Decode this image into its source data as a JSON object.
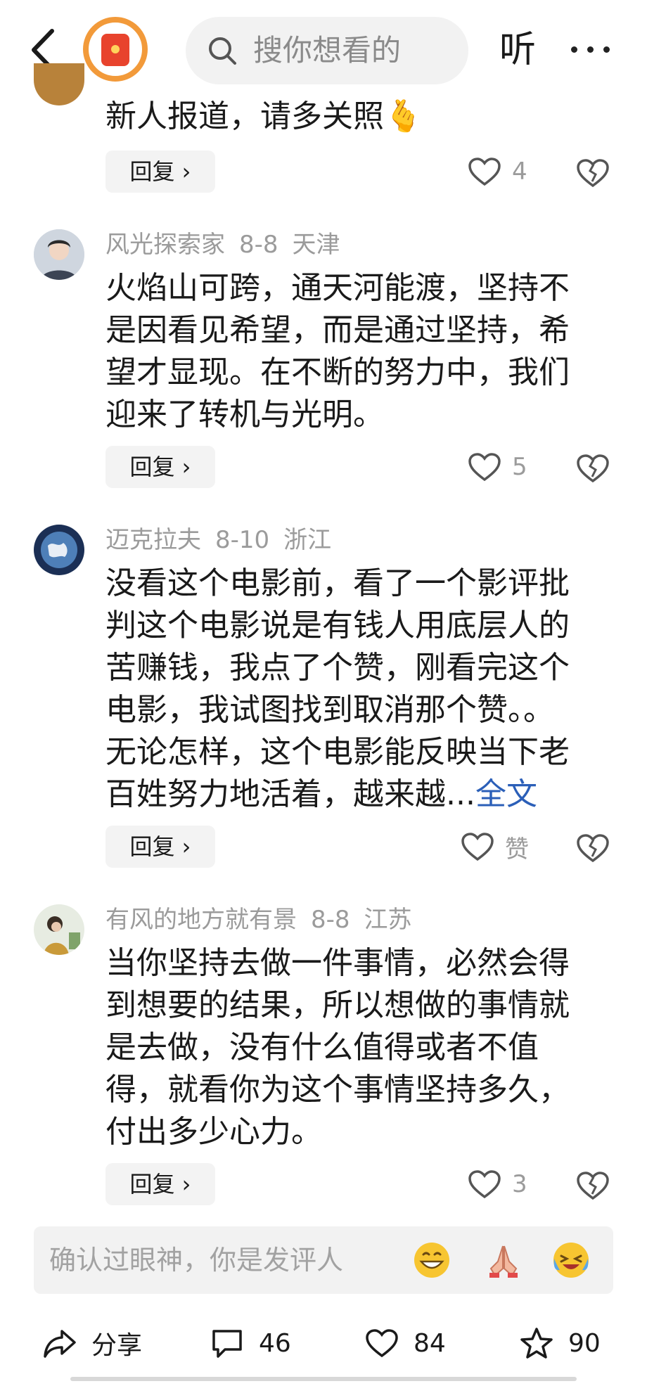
{
  "header": {
    "search_placeholder": "搜你想看的",
    "listen_label": "听"
  },
  "comments": [
    {
      "text": "新人报道，请多关照🫰",
      "reply_label": "回复 ›",
      "like_count": "4"
    },
    {
      "username": "风光探索家",
      "date": "8-8",
      "location": "天津",
      "text": "火焰山可跨，通天河能渡，坚持不\n是因看见希望，而是通过坚持，希\n望才显现。在不断的努力中，我们\n迎来了转机与光明。",
      "reply_label": "回复 ›",
      "like_count": "5"
    },
    {
      "username": "迈克拉夫",
      "date": "8-10",
      "location": "浙江",
      "text": "没看这个电影前，看了一个影评批\n判这个电影说是有钱人用底层人的\n苦赚钱，我点了个赞，刚看完这个\n电影，我试图找到取消那个赞。。\n无论怎样，这个电影能反映当下老\n百姓努力地活着，越来越...",
      "more_label": "全文",
      "reply_label": "回复 ›",
      "like_count": "赞"
    },
    {
      "username": "有风的地方就有景",
      "date": "8-8",
      "location": "江苏",
      "text": "当你坚持去做一件事情，必然会得\n到想要的结果，所以想做的事情就\n是去做，没有什么值得或者不值\n得，就看你为这个事情坚持多久，\n付出多少心力。",
      "reply_label": "回复 ›",
      "like_count": "3"
    }
  ],
  "input_bar": {
    "placeholder": "确认过眼神，你是发评人",
    "emojis": [
      "grinning-emoji",
      "pray-emoji",
      "crying-laughing-emoji"
    ]
  },
  "bottom_bar": {
    "share_label": "分享",
    "comment_count": "46",
    "like_count": "84",
    "favorite_count": "90"
  },
  "colors": {
    "accent_orange": "#f29a3a",
    "redpack": "#e8432d",
    "link_blue": "#2b5fb8",
    "meta_gray": "#9b9b9b"
  }
}
